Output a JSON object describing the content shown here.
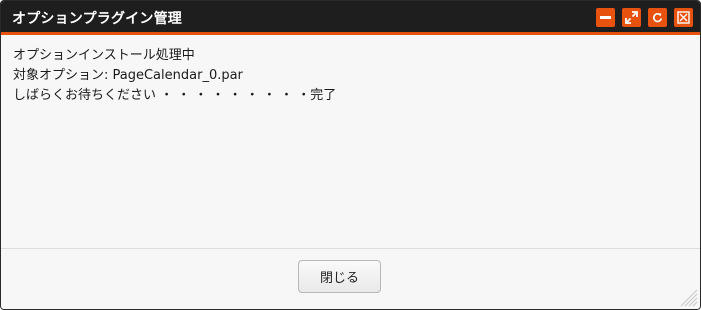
{
  "window": {
    "title": "オプションプラグイン管理",
    "accent_color": "#e8520f",
    "titlebar_color": "#1e1e1e",
    "buttons": [
      {
        "name": "minimize-button",
        "icon": "minimize-icon"
      },
      {
        "name": "maximize-button",
        "icon": "expand-icon"
      },
      {
        "name": "refresh-button",
        "icon": "refresh-icon"
      },
      {
        "name": "close-window-button",
        "icon": "close-box-icon"
      }
    ]
  },
  "content": {
    "line1": "オプションインストール処理中",
    "line2": "対象オプション: PageCalendar_0.par",
    "line3": "しばらくお待ちください ・ ・ ・ ・ ・ ・ ・ ・ ・完了"
  },
  "footer": {
    "close_label": "閉じる"
  }
}
